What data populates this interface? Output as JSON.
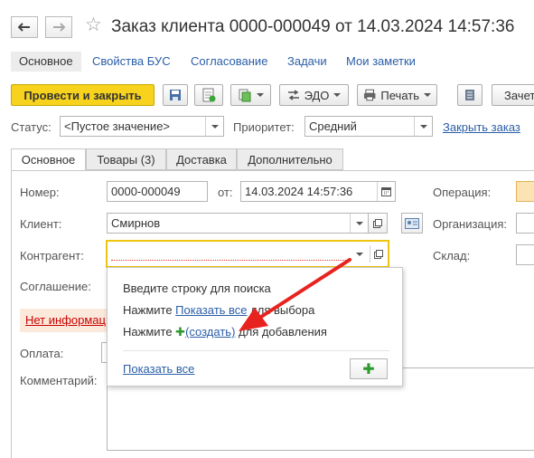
{
  "window": {
    "title": "Заказ клиента 0000-000049 от 14.03.2024 14:57:36"
  },
  "subtabs": [
    {
      "label": "Основное"
    },
    {
      "label": "Свойства БУС"
    },
    {
      "label": "Согласование"
    },
    {
      "label": "Задачи"
    },
    {
      "label": "Мои заметки"
    }
  ],
  "toolbar": {
    "post_close": "Провести и закрыть",
    "edo": "ЭДО",
    "print": "Печать",
    "last_cut": "Зачет"
  },
  "status_row": {
    "status_label": "Статус:",
    "status_value": "<Пустое значение>",
    "priority_label": "Приоритет:",
    "priority_value": "Средний",
    "close_order": "Закрыть заказ"
  },
  "form_tabs": [
    {
      "label": "Основное"
    },
    {
      "label": "Товары (3)"
    },
    {
      "label": "Доставка"
    },
    {
      "label": "Дополнительно"
    }
  ],
  "form": {
    "number_label": "Номер:",
    "number_value": "0000-000049",
    "from_label": "от:",
    "date_value": "14.03.2024 14:57:36",
    "operation_label": "Операция:",
    "client_label": "Клиент:",
    "client_value": "Смирнов",
    "organization_label": "Организация:",
    "counterparty_label": "Контрагент:",
    "counterparty_value": "",
    "warehouse_label": "Склад:",
    "agreement_label": "Соглашение:",
    "warning": "Нет информац",
    "payment_label": "Оплата:",
    "comment_label": "Комментарий:"
  },
  "popup": {
    "hint1": "Введите строку для поиска",
    "hint2_prefix": "Нажмите ",
    "hint2_link": "Показать все",
    "hint2_suffix": " для выбора",
    "hint3_prefix": "Нажмите ",
    "hint3_link": "(создать)",
    "hint3_suffix": " для добавления",
    "show_all": "Показать все"
  },
  "colors": {
    "primary_button": "#f7d31d",
    "link": "#2a5ea8",
    "active_field_border": "#f0c30c",
    "arrow": "#e8231f",
    "add_green": "#2c9a2c"
  }
}
